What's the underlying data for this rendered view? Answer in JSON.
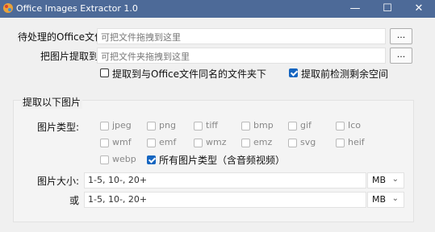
{
  "window": {
    "title": "Office Images Extractor 1.0",
    "min_glyph": "—",
    "max_glyph": "☐",
    "close_glyph": "✕",
    "titlebar_color": "#4d6a98"
  },
  "top": {
    "office_file_label": "待处理的Office文件",
    "office_file_placeholder": "可把文件拖拽到这里",
    "extract_to_label": "把图片提取到",
    "extract_to_placeholder": "可把文件夹拖拽到这里",
    "browse_label": "...",
    "same_folder_label": "提取到与Office文件同名的文件夹下",
    "same_folder_checked": false,
    "check_space_label": "提取前检测剩余空间",
    "check_space_checked": true
  },
  "group": {
    "title": "提取以下图片",
    "types_label": "图片类型:",
    "types": [
      {
        "label": "jpeg",
        "checked": false
      },
      {
        "label": "png",
        "checked": false
      },
      {
        "label": "tiff",
        "checked": false
      },
      {
        "label": "bmp",
        "checked": false
      },
      {
        "label": "gif",
        "checked": false
      },
      {
        "label": "Ico",
        "checked": false
      },
      {
        "label": "wmf",
        "checked": false
      },
      {
        "label": "emf",
        "checked": false
      },
      {
        "label": "wmz",
        "checked": false
      },
      {
        "label": "emz",
        "checked": false
      },
      {
        "label": "svg",
        "checked": false
      },
      {
        "label": "heif",
        "checked": false
      },
      {
        "label": "webp",
        "checked": false
      }
    ],
    "all_types_label": "所有图片类型（含音频视频）",
    "all_types_checked": true,
    "size_label": "图片大小:",
    "size_value": "1-5, 10-, 20+",
    "size_unit": "MB",
    "or_label": "或",
    "or_value": "1-5, 10-, 20+",
    "or_unit": "MB",
    "accent_color": "#1565c0"
  }
}
